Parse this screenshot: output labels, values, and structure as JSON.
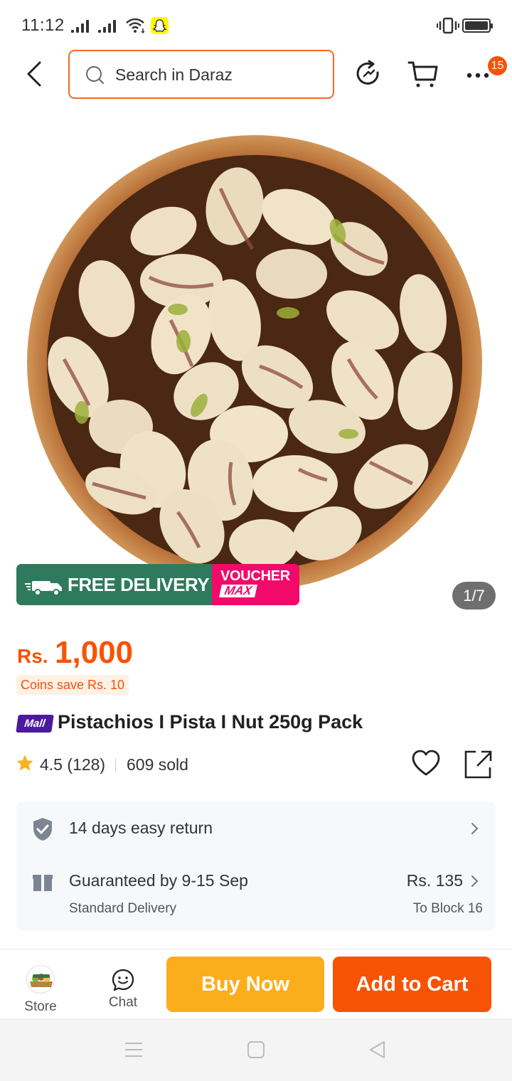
{
  "status_bar": {
    "time": "11:12"
  },
  "header": {
    "search_placeholder": "Search in Daraz",
    "more_badge": "15"
  },
  "product_image": {
    "banner_free_tag": "FREE",
    "banner_free_delivery": "FREE DELIVERY",
    "banner_voucher": "VOUCHER",
    "banner_max": "MAX",
    "counter": "1/7"
  },
  "price": {
    "currency": "Rs.",
    "amount": "1,000",
    "coins_save": "Coins save Rs. 10"
  },
  "product": {
    "mall_badge": "Mall",
    "title": "Pistachios I Pista I Nut  250g Pack",
    "rating": "4.5 (128)",
    "sold": "609 sold"
  },
  "info": {
    "return_policy": "14 days easy return",
    "guarantee": "Guaranteed by 9-15 Sep",
    "delivery_type": "Standard Delivery",
    "delivery_fee": "Rs. 135",
    "location": "To Block 16"
  },
  "bottom_bar": {
    "store_label": "Store",
    "chat_label": "Chat",
    "buy_now_label": "Buy Now",
    "add_to_cart_label": "Add to Cart"
  },
  "colors": {
    "accent": "#f75306",
    "buy_now": "#fcad1c",
    "delivery_banner": "#2f7a5f",
    "voucher_banner": "#f20a6a",
    "mall_badge": "#4b1a9e"
  }
}
